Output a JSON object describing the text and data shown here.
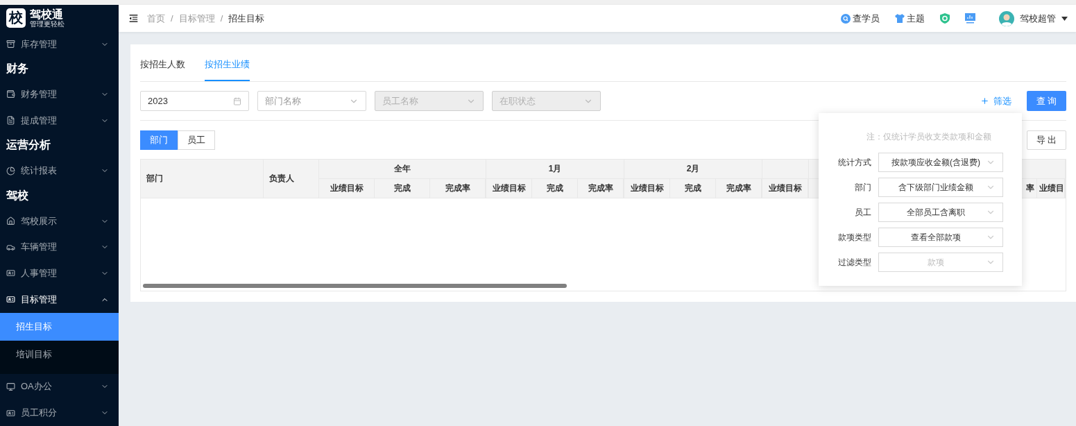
{
  "sidebar": {
    "logo": {
      "mark": "校",
      "name": "驾校通",
      "slogan": "管理更轻松"
    },
    "items": [
      {
        "kind": "menu",
        "label": "库存管理",
        "expanded": false
      },
      {
        "kind": "heading",
        "label": "财务"
      },
      {
        "kind": "menu",
        "label": "财务管理",
        "expanded": false
      },
      {
        "kind": "menu",
        "label": "提成管理",
        "expanded": false
      },
      {
        "kind": "heading",
        "label": "运营分析"
      },
      {
        "kind": "menu",
        "label": "统计报表",
        "expanded": false
      },
      {
        "kind": "heading",
        "label": "驾校"
      },
      {
        "kind": "menu",
        "label": "驾校展示",
        "expanded": false
      },
      {
        "kind": "menu",
        "label": "车辆管理",
        "expanded": false
      },
      {
        "kind": "menu",
        "label": "人事管理",
        "expanded": false
      },
      {
        "kind": "menu",
        "label": "目标管理",
        "expanded": true,
        "children": [
          {
            "label": "招生目标",
            "selected": true
          },
          {
            "label": "培训目标",
            "selected": false
          }
        ]
      },
      {
        "kind": "menu",
        "label": "OA办公",
        "expanded": false
      },
      {
        "kind": "menu",
        "label": "员工积分",
        "expanded": false
      }
    ]
  },
  "header": {
    "breadcrumb": {
      "separator": "/",
      "items": [
        "首页",
        "目标管理",
        "招生目标"
      ]
    },
    "tools": [
      {
        "kind": "search",
        "label": "查学员"
      },
      {
        "kind": "theme",
        "label": "主题"
      },
      {
        "kind": "shield"
      },
      {
        "kind": "chart"
      }
    ],
    "user": {
      "name": "驾校超管"
    }
  },
  "tabs": [
    {
      "label": "按招生人数",
      "selected": false
    },
    {
      "label": "按招生业绩",
      "selected": true
    }
  ],
  "filters": [
    {
      "kind": "date",
      "value": "2023",
      "disabled": false
    },
    {
      "kind": "select",
      "placeholder": "部门名称",
      "disabled": false
    },
    {
      "kind": "select",
      "placeholder": "员工名称",
      "disabled": true
    },
    {
      "kind": "select",
      "placeholder": "在职状态",
      "disabled": true
    }
  ],
  "filter_link": "筛选",
  "query_button": "查 询",
  "export_button": "导 出",
  "view_toggle": [
    {
      "label": "部门",
      "selected": true
    },
    {
      "label": "员工",
      "selected": false
    }
  ],
  "table": {
    "fixed_columns": [
      "部门",
      "负责人"
    ],
    "groups": [
      {
        "label": "全年",
        "columns": [
          "业绩目标",
          "完成",
          "完成率"
        ]
      },
      {
        "label": "1月",
        "columns": [
          "业绩目标",
          "完成",
          "完成率"
        ]
      },
      {
        "label": "2月",
        "columns": [
          "业绩目标",
          "完成",
          "完成率"
        ]
      },
      {
        "columns": [
          "业绩目标"
        ]
      }
    ],
    "trailing_columns": [
      "率",
      "业绩目"
    ]
  },
  "filter_popover": {
    "note": "注：仅统计学员收支类款项和金额",
    "fields": [
      {
        "label": "统计方式",
        "value": "按款项应收金额(含退费)",
        "disabled": false
      },
      {
        "label": "部门",
        "value": "含下级部门业绩金额",
        "disabled": false
      },
      {
        "label": "员工",
        "value": "全部员工含离职",
        "disabled": false
      },
      {
        "label": "款项类型",
        "value": "查看全部款项",
        "disabled": false
      },
      {
        "label": "过滤类型",
        "value": "款项",
        "disabled": true
      }
    ]
  }
}
